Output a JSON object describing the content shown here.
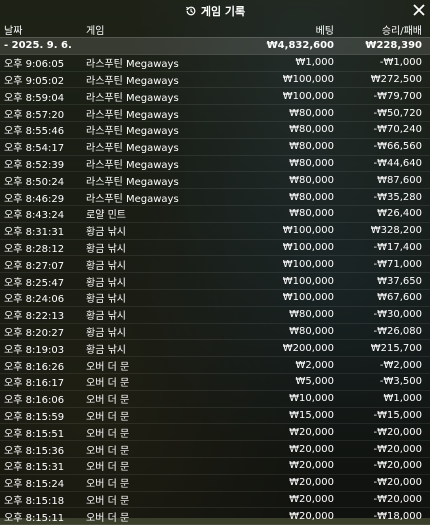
{
  "title": "게임 기록",
  "icons": {
    "title": "history-icon",
    "close": "close-icon"
  },
  "columns": {
    "date": "날짜",
    "game": "게임",
    "bet": "베팅",
    "winloss": "승리/패배"
  },
  "summary": {
    "date": "- 2025. 9. 6.",
    "bet": "₩4,832,600",
    "winloss": "₩228,390"
  },
  "rows": [
    {
      "time": "오후 9:06:05",
      "game": "라스푸틴 Megaways",
      "bet": "₩1,000",
      "winloss": "-₩1,000"
    },
    {
      "time": "오후 9:05:02",
      "game": "라스푸틴 Megaways",
      "bet": "₩100,000",
      "winloss": "₩272,500"
    },
    {
      "time": "오후 8:59:04",
      "game": "라스푸틴 Megaways",
      "bet": "₩100,000",
      "winloss": "-₩79,700"
    },
    {
      "time": "오후 8:57:20",
      "game": "라스푸틴 Megaways",
      "bet": "₩80,000",
      "winloss": "-₩50,720"
    },
    {
      "time": "오후 8:55:46",
      "game": "라스푸틴 Megaways",
      "bet": "₩80,000",
      "winloss": "-₩70,240"
    },
    {
      "time": "오후 8:54:17",
      "game": "라스푸틴 Megaways",
      "bet": "₩80,000",
      "winloss": "-₩66,560"
    },
    {
      "time": "오후 8:52:39",
      "game": "라스푸틴 Megaways",
      "bet": "₩80,000",
      "winloss": "-₩44,640"
    },
    {
      "time": "오후 8:50:24",
      "game": "라스푸틴 Megaways",
      "bet": "₩80,000",
      "winloss": "₩87,600"
    },
    {
      "time": "오후 8:46:29",
      "game": "라스푸틴 Megaways",
      "bet": "₩80,000",
      "winloss": "-₩35,280"
    },
    {
      "time": "오후 8:43:24",
      "game": "로얄 민트",
      "bet": "₩80,000",
      "winloss": "₩26,400"
    },
    {
      "time": "오후 8:31:31",
      "game": "황금 낚시",
      "bet": "₩100,000",
      "winloss": "₩328,200"
    },
    {
      "time": "오후 8:28:12",
      "game": "황금 낚시",
      "bet": "₩100,000",
      "winloss": "-₩17,400"
    },
    {
      "time": "오후 8:27:07",
      "game": "황금 낚시",
      "bet": "₩100,000",
      "winloss": "-₩71,000"
    },
    {
      "time": "오후 8:25:47",
      "game": "황금 낚시",
      "bet": "₩100,000",
      "winloss": "₩37,650"
    },
    {
      "time": "오후 8:24:06",
      "game": "황금 낚시",
      "bet": "₩100,000",
      "winloss": "₩67,600"
    },
    {
      "time": "오후 8:22:13",
      "game": "황금 낚시",
      "bet": "₩80,000",
      "winloss": "-₩30,000"
    },
    {
      "time": "오후 8:20:27",
      "game": "황금 낚시",
      "bet": "₩80,000",
      "winloss": "-₩26,080"
    },
    {
      "time": "오후 8:19:03",
      "game": "황금 낚시",
      "bet": "₩200,000",
      "winloss": "₩215,700"
    },
    {
      "time": "오후 8:16:26",
      "game": "오버 더 문",
      "bet": "₩2,000",
      "winloss": "-₩2,000"
    },
    {
      "time": "오후 8:16:17",
      "game": "오버 더 문",
      "bet": "₩5,000",
      "winloss": "-₩3,500"
    },
    {
      "time": "오후 8:16:06",
      "game": "오버 더 문",
      "bet": "₩10,000",
      "winloss": "₩1,000"
    },
    {
      "time": "오후 8:15:59",
      "game": "오버 더 문",
      "bet": "₩15,000",
      "winloss": "-₩15,000"
    },
    {
      "time": "오후 8:15:51",
      "game": "오버 더 문",
      "bet": "₩20,000",
      "winloss": "-₩20,000"
    },
    {
      "time": "오후 8:15:36",
      "game": "오버 더 문",
      "bet": "₩20,000",
      "winloss": "-₩20,000"
    },
    {
      "time": "오후 8:15:31",
      "game": "오버 더 문",
      "bet": "₩20,000",
      "winloss": "-₩20,000"
    },
    {
      "time": "오후 8:15:24",
      "game": "오버 더 문",
      "bet": "₩20,000",
      "winloss": "-₩20,000"
    },
    {
      "time": "오후 8:15:18",
      "game": "오버 더 문",
      "bet": "₩20,000",
      "winloss": "-₩20,000"
    },
    {
      "time": "오후 8:15:11",
      "game": "오버 더 문",
      "bet": "₩20,000",
      "winloss": "-₩18,000"
    }
  ]
}
